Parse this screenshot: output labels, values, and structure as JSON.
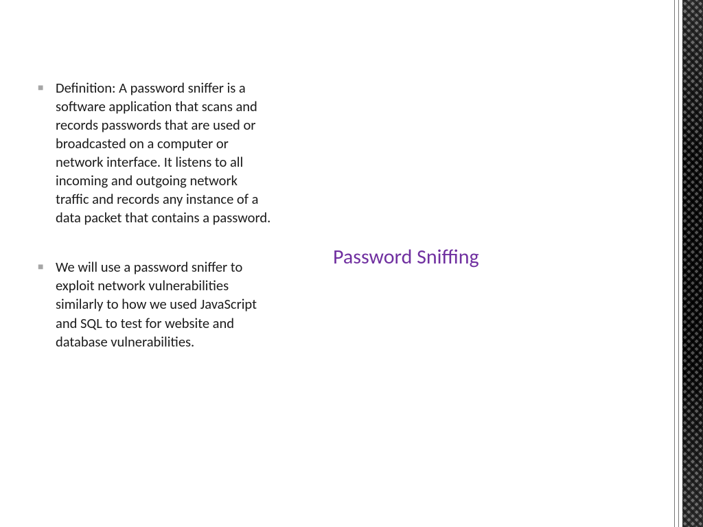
{
  "slide": {
    "title": "Password Sniffing",
    "bullets": [
      "Definition: A password sniffer is a software application that scans and records passwords that are used or broadcasted on a computer or network interface. It listens to all incoming and outgoing network traffic and records any instance of a data packet that contains a password.",
      "We will use a password sniffer to exploit network vulnerabilities similarly to how we used JavaScript and SQL to test for website and database vulnerabilities."
    ],
    "colors": {
      "title": "#7030a0",
      "bullet_marker": "#a6a6a6",
      "text": "#1a1a1a"
    }
  }
}
